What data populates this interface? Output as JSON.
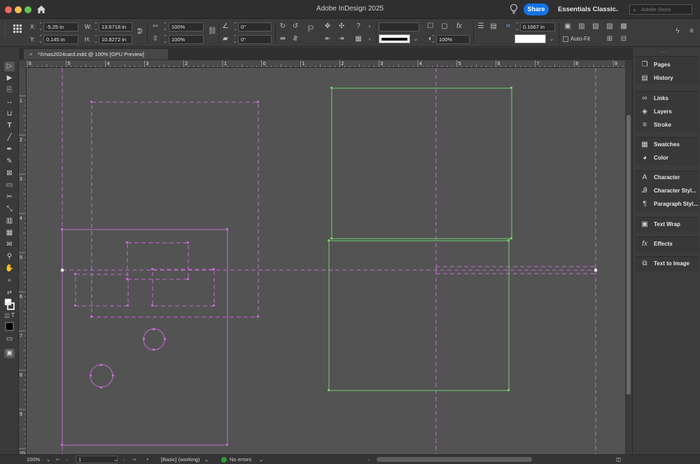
{
  "window": {
    "title": "Adobe InDesign 2025",
    "share_label": "Share",
    "workspace": "Essentials Classic",
    "stock_placeholder": "Adobe Stock",
    "icons": [
      "close-icon",
      "minimize-icon",
      "zoom-icon",
      "home-icon",
      "lightbulb-icon"
    ]
  },
  "controls": {
    "x_label": "X:",
    "x_value": "-5.25 in",
    "y_label": "Y:",
    "y_value": "0.145 in",
    "w_label": "W:",
    "w_value": "13.6718 in",
    "h_label": "H:",
    "h_value": "10.8272 in",
    "scale_x": "100%",
    "scale_y": "100%",
    "rotation": "0°",
    "shear": "0°",
    "opacity": "100%",
    "stroke_weight": "0.1667 in",
    "autofit_label": "Auto-Fit",
    "autofit_checked": false
  },
  "tab": {
    "title": "*Xmas2024card.indd @ 100% [GPU Preview]",
    "close": "×"
  },
  "rulers": {
    "horizontal": [
      "6",
      "5",
      "4",
      "3",
      "2",
      "1",
      "0",
      "1",
      "2",
      "3",
      "4",
      "5",
      "6",
      "7",
      "8",
      "9"
    ],
    "vertical": [
      "1",
      "2",
      "3",
      "4",
      "5",
      "6",
      "7",
      "8",
      "9",
      "10"
    ]
  },
  "panels": [
    {
      "items": [
        {
          "label": "Pages",
          "icon": "pages-icon"
        },
        {
          "label": "History",
          "icon": "history-icon"
        }
      ]
    },
    {
      "items": [
        {
          "label": "Links",
          "icon": "links-icon"
        },
        {
          "label": "Layers",
          "icon": "layers-icon"
        },
        {
          "label": "Stroke",
          "icon": "stroke-icon"
        }
      ]
    },
    {
      "items": [
        {
          "label": "Swatches",
          "icon": "swatches-icon"
        },
        {
          "label": "Color",
          "icon": "color-icon"
        }
      ]
    },
    {
      "items": [
        {
          "label": "Character",
          "icon": "character-icon"
        },
        {
          "label": "Character Styl...",
          "icon": "character-styles-icon"
        },
        {
          "label": "Paragraph Styl...",
          "icon": "paragraph-styles-icon"
        }
      ]
    },
    {
      "items": [
        {
          "label": "Text Wrap",
          "icon": "text-wrap-icon"
        }
      ]
    },
    {
      "items": [
        {
          "label": "Effects",
          "icon": "effects-icon"
        }
      ]
    },
    {
      "items": [
        {
          "label": "Text to Image",
          "icon": "text-to-image-icon"
        }
      ]
    }
  ],
  "status": {
    "zoom": "100%",
    "page": "1",
    "preflight_profile": "[Basic] (working)",
    "errors": "No errors",
    "error_color": "#2d9d3a"
  },
  "colors": {
    "accent": "#1473e6",
    "frame_magenta": "#c56ad6",
    "frame_green": "#6fcf6f",
    "canvas": "#535353"
  }
}
